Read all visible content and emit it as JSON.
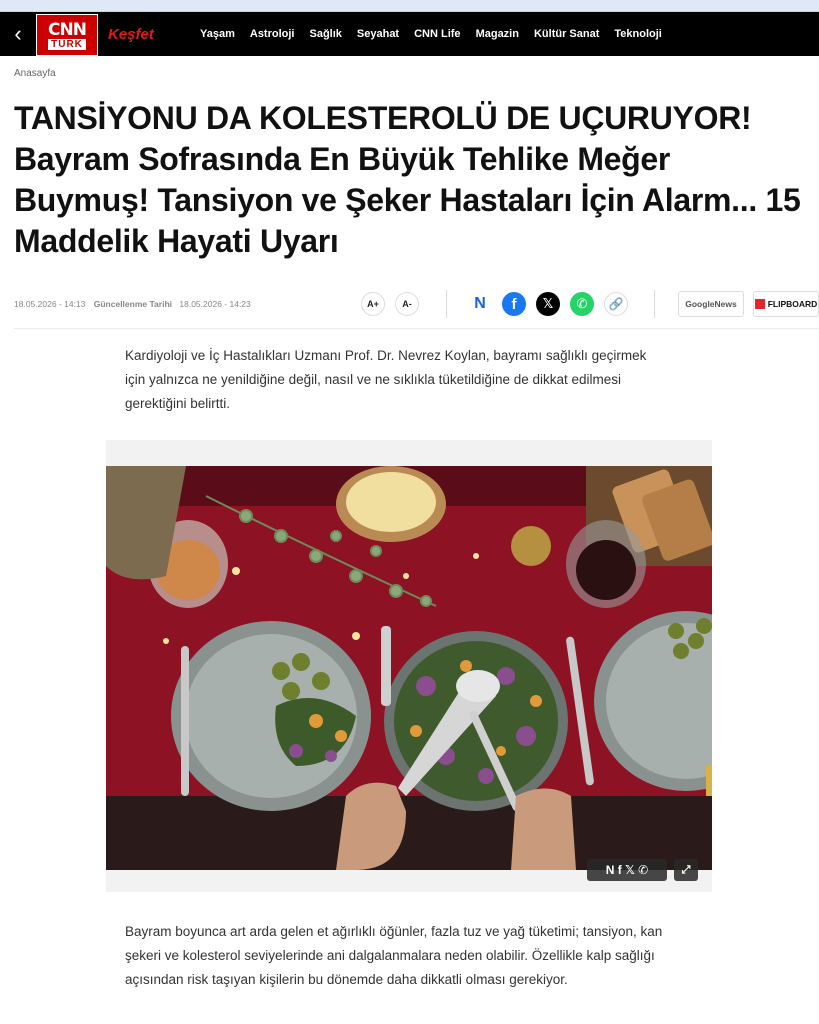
{
  "header": {
    "logo_cnn": "CNN",
    "logo_turk": "TÜRK",
    "kesfet": "Keşfet",
    "nav": [
      "Yaşam",
      "Astroloji",
      "Sağlık",
      "Seyahat",
      "CNN Life",
      "Magazin",
      "Kültür Sanat",
      "Teknoloji"
    ]
  },
  "breadcrumb": "Anasayfa",
  "article": {
    "title": "TANSİYONU DA KOLESTEROLÜ DE UÇURUYOR! Bayram Sofrasında En Büyük Tehlike Meğer Buymuş! Tansiyon ve Şeker Hastaları İçin Alarm... 15 Maddelik Hayati Uyarı",
    "published": "18.05.2026 - 14:13",
    "updated_label": "Güncellenme Tarihi",
    "updated": "18.05.2026 - 14:23",
    "font_up": "A+",
    "font_down": "A-",
    "paragraph1": "Kardiyoloji ve İç Hastalıkları Uzmanı Prof. Dr. Nevrez Koylan, bayramı sağlıklı geçirmek için yalnızca ne yenildiğine değil, nasıl ve ne sıklıkla tüketildiğine de dikkat edilmesi gerektiğini belirtti.",
    "paragraph2": "Bayram boyunca art arda gelen et ağırlıklı öğünler, fazla tuz ve yağ tüketimi; tansiyon, kan şekeri ve kolesterol seviyelerinde ani dalgalanmalara neden olabilir. Özellikle kalp sağlığı açısından risk taşıyan kişilerin bu dönemde daha dikkatli olması gerekiyor."
  },
  "share": {
    "n": "N",
    "facebook": "f",
    "x": "𝕏",
    "whatsapp": "✆",
    "link": "🔗",
    "google_news": "GoogleNews",
    "flipboard": "FLIPBOARD"
  },
  "photo_overlay": {
    "share_icons": "N f 𝕏 ✆",
    "expand": "⤢"
  },
  "colors": {
    "brand_red": "#cc0000",
    "navbar": "#000000",
    "facebook": "#1877f2",
    "whatsapp": "#25d366"
  }
}
